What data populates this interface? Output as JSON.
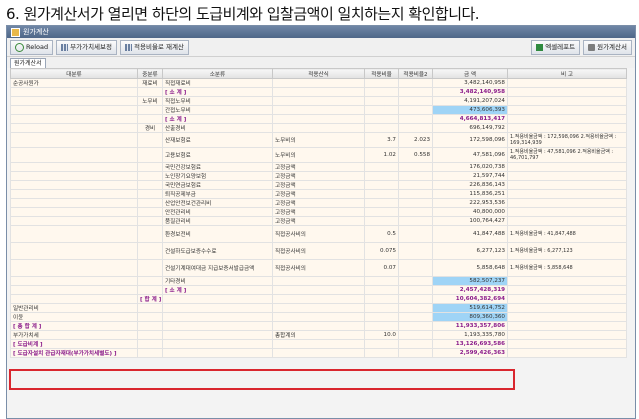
{
  "caption": "6. 원가계산서가 열리면 하단의 도급비계와 입찰금액이 일치하는지 확인합니다.",
  "window": {
    "title": "원가계산"
  },
  "toolbar": {
    "reload": "Reload",
    "vat_setting": "부가가치세보정",
    "rate_recalc": "적용비율로 재계산",
    "excel_report": "엑셀레포트",
    "cost_statement": "원가계산서"
  },
  "tab": "원가계산서",
  "columns": [
    "대분류",
    "중분류",
    "소분류",
    "적용산식",
    "적용비율",
    "적용비율2",
    "금 액",
    "비 고"
  ],
  "rows": [
    {
      "major": "순공사원가",
      "mid": "재료비",
      "minor": "직접재료비",
      "formula": "",
      "rate": "",
      "rate2": "",
      "amount": "3,482,140,958",
      "note": ""
    },
    {
      "major": "",
      "mid": "",
      "minor": "[ 소 계 ]",
      "formula": "",
      "rate": "",
      "rate2": "",
      "amount": "3,482,140,958",
      "note": ""
    },
    {
      "major": "",
      "mid": "노무비",
      "minor": "직접노무비",
      "formula": "",
      "rate": "",
      "rate2": "",
      "amount": "4,191,207,024",
      "note": ""
    },
    {
      "major": "",
      "mid": "",
      "minor": "간접노무비",
      "formula": "",
      "rate": "",
      "rate2": "",
      "amount": "473,606,393",
      "note": ""
    },
    {
      "major": "",
      "mid": "",
      "minor": "[ 소 계 ]",
      "formula": "",
      "rate": "",
      "rate2": "",
      "amount": "4,664,813,417",
      "note": ""
    },
    {
      "major": "",
      "mid": "경비",
      "minor": "산출경비",
      "formula": "",
      "rate": "",
      "rate2": "",
      "amount": "696,149,792",
      "note": ""
    },
    {
      "major": "",
      "mid": "",
      "minor": "산재보험료",
      "formula": "노무비의",
      "rate": "3.7",
      "rate2": "2.023",
      "amount": "172,598,096",
      "note": "1.적용비율금액 : 172,598,096\n2.적용비율금액 : 169,314,939"
    },
    {
      "major": "",
      "mid": "",
      "minor": "고용보험료",
      "formula": "노무비의",
      "rate": "1.02",
      "rate2": "0.558",
      "amount": "47,581,096",
      "note": "1.적용비율금액 : 47,581,096\n2.적용비율금액 : 46,701,797"
    },
    {
      "major": "",
      "mid": "",
      "minor": "국민건강보험료",
      "formula": "고정금액",
      "rate": "",
      "rate2": "",
      "amount": "176,020,738",
      "note": ""
    },
    {
      "major": "",
      "mid": "",
      "minor": "노인장기요양보험",
      "formula": "고정금액",
      "rate": "",
      "rate2": "",
      "amount": "21,597,744",
      "note": ""
    },
    {
      "major": "",
      "mid": "",
      "minor": "국민연금보험료",
      "formula": "고정금액",
      "rate": "",
      "rate2": "",
      "amount": "226,836,143",
      "note": ""
    },
    {
      "major": "",
      "mid": "",
      "minor": "퇴직공제부금",
      "formula": "고정금액",
      "rate": "",
      "rate2": "",
      "amount": "115,836,251",
      "note": ""
    },
    {
      "major": "",
      "mid": "",
      "minor": "산업안전보건관리비",
      "formula": "고정금액",
      "rate": "",
      "rate2": "",
      "amount": "222,953,536",
      "note": ""
    },
    {
      "major": "",
      "mid": "",
      "minor": "안전관리비",
      "formula": "고정금액",
      "rate": "",
      "rate2": "",
      "amount": "40,800,000",
      "note": ""
    },
    {
      "major": "",
      "mid": "",
      "minor": "품질관리비",
      "formula": "고정금액",
      "rate": "",
      "rate2": "",
      "amount": "100,764,427",
      "note": ""
    },
    {
      "major": "",
      "mid": "",
      "minor": "환경보전비",
      "formula": "직접공사비의",
      "rate": "0.5",
      "rate2": "",
      "amount": "41,847,488",
      "note": "1.적용비율금액 : 41,847,488"
    },
    {
      "major": "",
      "mid": "",
      "minor": "건설하도급보증수수료",
      "formula": "직접공사비의",
      "rate": "0.075",
      "rate2": "",
      "amount": "6,277,123",
      "note": "1.적용비율금액 : 6,277,123"
    },
    {
      "major": "",
      "mid": "",
      "minor": "건설기계대여대금 지급보증서발급금액",
      "formula": "직접공사비의",
      "rate": "0.07",
      "rate2": "",
      "amount": "5,858,648",
      "note": "1.적용비율금액 : 5,858,648"
    },
    {
      "major": "",
      "mid": "",
      "minor": "기타경비",
      "formula": "",
      "rate": "",
      "rate2": "",
      "amount": "582,507,237",
      "note": ""
    },
    {
      "major": "",
      "mid": "",
      "minor": "[ 소 계 ]",
      "formula": "",
      "rate": "",
      "rate2": "",
      "amount": "2,457,428,319",
      "note": ""
    },
    {
      "major": "",
      "mid": "[ 합 계 ]",
      "minor": "",
      "formula": "",
      "rate": "",
      "rate2": "",
      "amount": "10,604,382,694",
      "note": ""
    },
    {
      "major": "일반관리비",
      "mid": "",
      "minor": "",
      "formula": "",
      "rate": "",
      "rate2": "",
      "amount": "519,614,752",
      "note": ""
    },
    {
      "major": "이윤",
      "mid": "",
      "minor": "",
      "formula": "",
      "rate": "",
      "rate2": "",
      "amount": "809,360,360",
      "note": ""
    },
    {
      "major": "[ 총 합 계 ]",
      "mid": "",
      "minor": "",
      "formula": "",
      "rate": "",
      "rate2": "",
      "amount": "11,933,357,806",
      "note": ""
    },
    {
      "major": "부가가치세",
      "mid": "",
      "minor": "",
      "formula": "총합계의",
      "rate": "10.0",
      "rate2": "",
      "amount": "1,193,335,780",
      "note": ""
    },
    {
      "major": "[ 도급비계 ]",
      "mid": "",
      "minor": "",
      "formula": "",
      "rate": "",
      "rate2": "",
      "amount": "13,126,693,586",
      "note": ""
    },
    {
      "major": "[ 도급자설치 관급자재대(부가가치세별도) ]",
      "mid": "",
      "minor": "",
      "formula": "",
      "rate": "",
      "rate2": "",
      "amount": "2,599,426,363",
      "note": ""
    }
  ]
}
